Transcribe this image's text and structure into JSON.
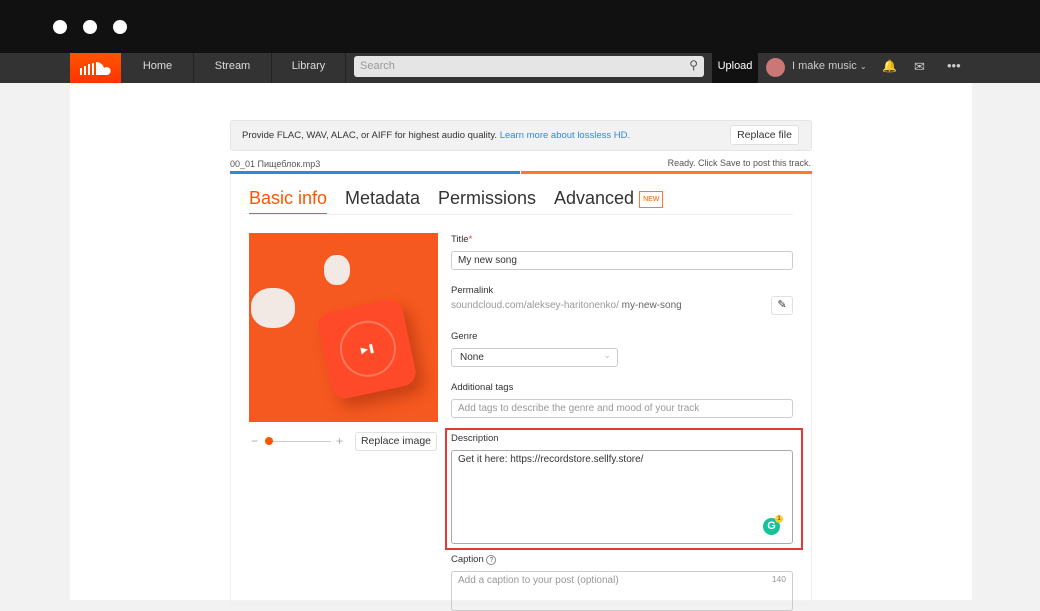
{
  "nav": {
    "home": "Home",
    "stream": "Stream",
    "library": "Library",
    "search_placeholder": "Search",
    "upload": "Upload",
    "user": "I make music"
  },
  "banner": {
    "text": "Provide FLAC, WAV, ALAC, or AIFF for highest audio quality.",
    "link": "Learn more about lossless HD.",
    "replace_file": "Replace file"
  },
  "file": {
    "name": "00_01 Пищеблок.mp3",
    "status": "Ready. Click Save to post this track.",
    "progress_percent": 100
  },
  "tabs": [
    {
      "label": "Basic info",
      "active": true
    },
    {
      "label": "Metadata"
    },
    {
      "label": "Permissions"
    },
    {
      "label": "Advanced",
      "badge": "NEW"
    }
  ],
  "image": {
    "replace": "Replace image",
    "zoom_minus": "−",
    "zoom_plus": "+"
  },
  "form": {
    "title_label": "Title",
    "required": "*",
    "title_value": "My new song",
    "permalink_label": "Permalink",
    "permalink_base": "soundcloud.com/aleksey-haritonenko/",
    "permalink_slug": "my-new-song",
    "genre_label": "Genre",
    "genre_value": "None",
    "tags_label": "Additional tags",
    "tags_placeholder": "Add tags to describe the genre and mood of your track",
    "description_label": "Description",
    "description_value": "Get it here: https://recordstore.sellfy.store/",
    "grammarly_count": "1",
    "caption_label": "Caption",
    "caption_help": "?",
    "caption_placeholder": "Add a caption to your post (optional)",
    "caption_limit": "140"
  },
  "colors": {
    "accent": "#ff5500",
    "highlight": "#e53935",
    "progress_blue": "#3385d6"
  }
}
